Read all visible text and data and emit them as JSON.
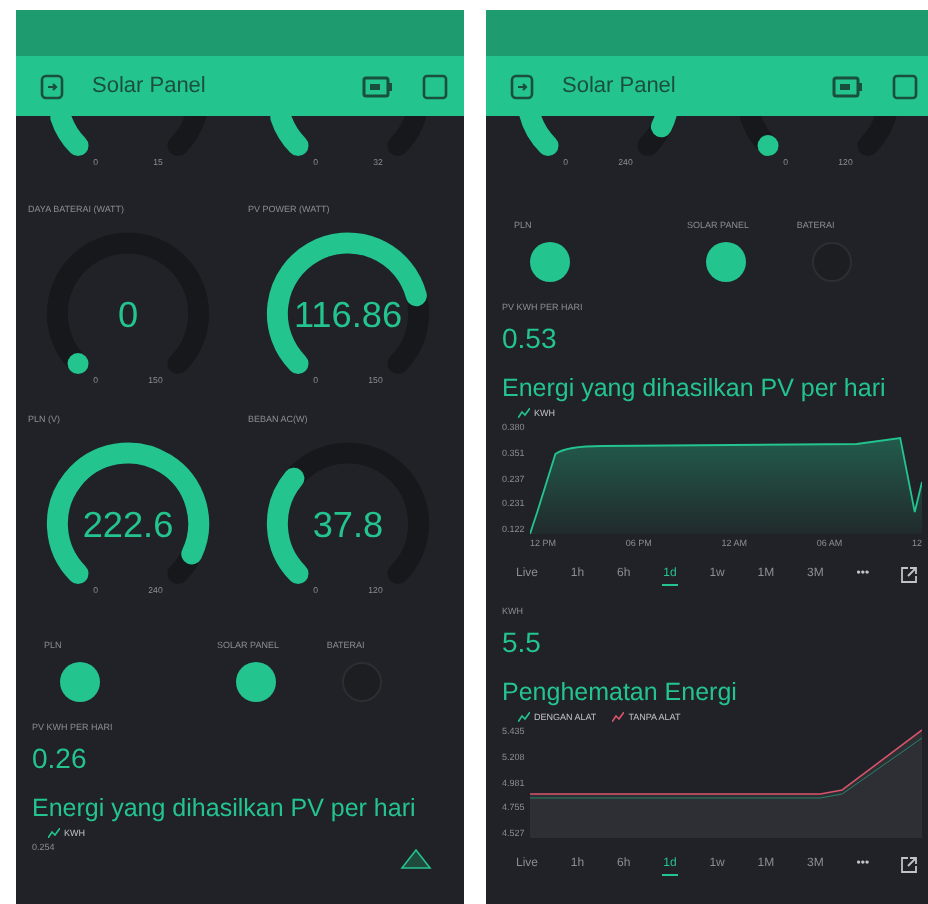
{
  "screens": [
    {
      "title": "Solar Panel",
      "widgets": [
        {
          "kind": "gauges",
          "cut": true,
          "gauges": [
            {
              "min": "0",
              "max": "15"
            },
            {
              "min": "0",
              "max": "32"
            }
          ]
        },
        {
          "kind": "gauges",
          "cut": false,
          "gauges": [
            {
              "label": "DAYA BATERAI (WATT)",
              "value": "0",
              "min": "0",
              "max": "150"
            },
            {
              "label": "PV POWER (WATT)",
              "value": "116.86",
              "min": "0",
              "max": "150"
            }
          ]
        },
        {
          "kind": "gauges",
          "cut": false,
          "gauges": [
            {
              "label": "PLN (V)",
              "value": "222.6",
              "min": "0",
              "max": "240"
            },
            {
              "label": "BEBAN AC(W)",
              "value": "37.8",
              "min": "0",
              "max": "120"
            }
          ]
        },
        {
          "kind": "lamps",
          "lamps": [
            {
              "label": "PLN",
              "on": true
            },
            {
              "label": "SOLAR PANEL",
              "on": true
            },
            {
              "label": "BATERAI",
              "on": false
            }
          ]
        },
        {
          "kind": "value",
          "label": "PV KWH PER HARI",
          "value": "0.26"
        },
        {
          "kind": "chart",
          "plot": {
            "kind": "peak"
          },
          "title": "Energi yang dihasilkan PV per hari",
          "legend": [
            {
              "label": "KWH",
              "color": "#23c48e"
            }
          ],
          "yticks": [
            "0.254"
          ]
        }
      ]
    },
    {
      "title": "Solar Panel",
      "widgets": [
        {
          "kind": "gauges",
          "cut": true,
          "gauges": [
            {
              "min": "0",
              "max": "240"
            },
            {
              "min": "0",
              "max": "120"
            }
          ]
        },
        {
          "kind": "lamps",
          "lamps": [
            {
              "label": "PLN",
              "on": true
            },
            {
              "label": "SOLAR PANEL",
              "on": true
            },
            {
              "label": "BATERAI",
              "on": false
            }
          ]
        },
        {
          "kind": "value",
          "label": "PV KWH PER HARI",
          "value": "0.53"
        },
        {
          "kind": "chart",
          "plot": {
            "kind": "plateau"
          },
          "title": "Energi yang dihasilkan PV per hari",
          "legend": [
            {
              "label": "KWH",
              "color": "#23c48e"
            }
          ],
          "yticks": [
            "0.380",
            "0.351",
            "0.237",
            "0.231",
            "0.122"
          ],
          "xticks": [
            "12 PM",
            "06 PM",
            "12 AM",
            "06 AM",
            "12"
          ]
        },
        {
          "kind": "ranges",
          "items": [
            {
              "label": "Live",
              "selected": false
            },
            {
              "label": "1h",
              "selected": false
            },
            {
              "label": "6h",
              "selected": false
            },
            {
              "label": "1d",
              "selected": true
            },
            {
              "label": "1w",
              "selected": false
            },
            {
              "label": "1M",
              "selected": false
            },
            {
              "label": "3M",
              "selected": false
            }
          ],
          "more": "•••"
        },
        {
          "kind": "value",
          "label": "KWH",
          "value": "5.5"
        },
        {
          "kind": "chart",
          "plot": {
            "kind": "rise"
          },
          "title": "Penghematan Energi",
          "legend": [
            {
              "label": "DENGAN ALAT",
              "color": "#23c48e"
            },
            {
              "label": "TANPA ALAT",
              "color": "#d9546b"
            }
          ],
          "yticks": [
            "5.435",
            "5.208",
            "4.981",
            "4.755",
            "4.527"
          ]
        },
        {
          "kind": "ranges",
          "items": [
            {
              "label": "Live",
              "selected": false
            },
            {
              "label": "1h",
              "selected": false
            },
            {
              "label": "6h",
              "selected": false
            },
            {
              "label": "1d",
              "selected": true
            },
            {
              "label": "1w",
              "selected": false
            },
            {
              "label": "1M",
              "selected": false
            },
            {
              "label": "3M",
              "selected": false
            }
          ],
          "more": "•••"
        }
      ]
    }
  ]
}
